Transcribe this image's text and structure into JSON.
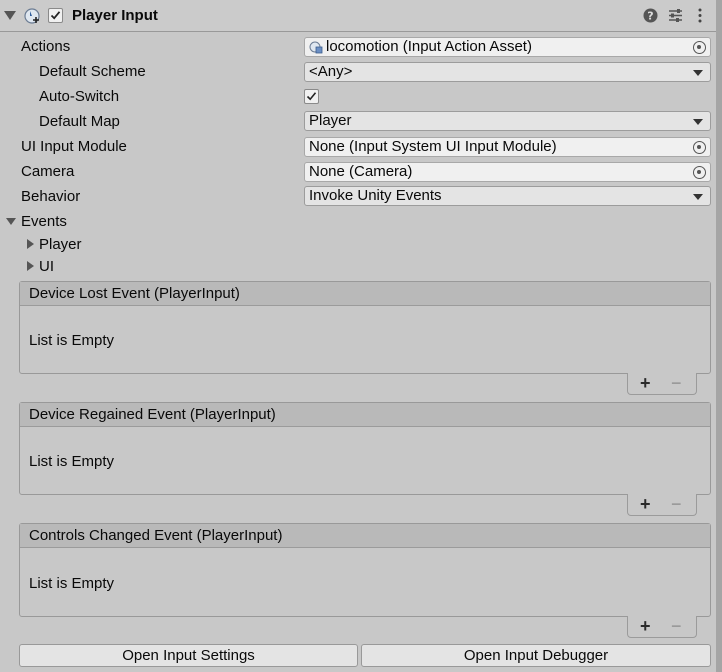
{
  "header": {
    "title": "Player Input",
    "enabled": true,
    "icons": [
      "help-icon",
      "preset-icon",
      "kebab-menu-icon"
    ]
  },
  "properties": {
    "actions": {
      "label": "Actions",
      "value": "locomotion (Input Action Asset)"
    },
    "default_scheme": {
      "label": "Default Scheme",
      "value": "<Any>"
    },
    "auto_switch": {
      "label": "Auto-Switch",
      "checked": true
    },
    "default_map": {
      "label": "Default Map",
      "value": "Player"
    },
    "ui_input_module": {
      "label": "UI Input Module",
      "value": "None (Input System UI Input Module)"
    },
    "camera": {
      "label": "Camera",
      "value": "None (Camera)"
    },
    "behavior": {
      "label": "Behavior",
      "value": "Invoke Unity Events"
    }
  },
  "events": {
    "label": "Events",
    "groups": [
      "Player",
      "UI"
    ],
    "lists": [
      {
        "title": "Device Lost Event (PlayerInput)",
        "empty_text": "List is Empty"
      },
      {
        "title": "Device Regained Event (PlayerInput)",
        "empty_text": "List is Empty"
      },
      {
        "title": "Controls Changed Event (PlayerInput)",
        "empty_text": "List is Empty"
      }
    ],
    "add_symbol": "+",
    "remove_symbol": "−"
  },
  "buttons": {
    "open_settings": "Open Input Settings",
    "open_debugger": "Open Input Debugger"
  }
}
